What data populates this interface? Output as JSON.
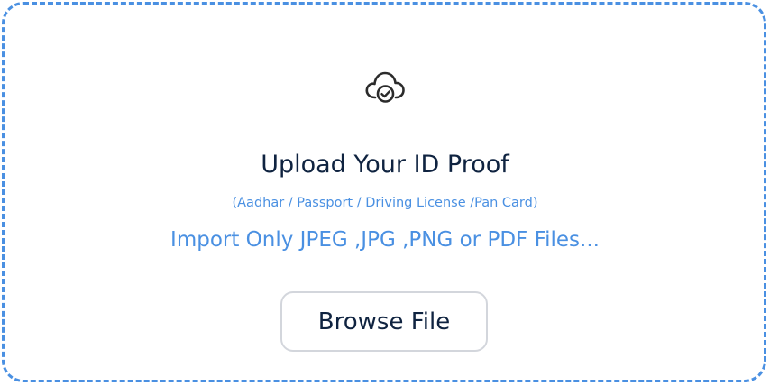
{
  "upload": {
    "icon": "cloud-check-icon",
    "title": "Upload Your ID Proof",
    "subtitle": "(Aadhar / Passport / Driving License /Pan Card)",
    "formats_text": "Import Only JPEG ,JPG ,PNG or PDF Files...",
    "browse_label": "Browse File"
  },
  "colors": {
    "accent": "#4a90e2",
    "title_text": "#0f2340",
    "button_border": "#d3d6dc"
  }
}
